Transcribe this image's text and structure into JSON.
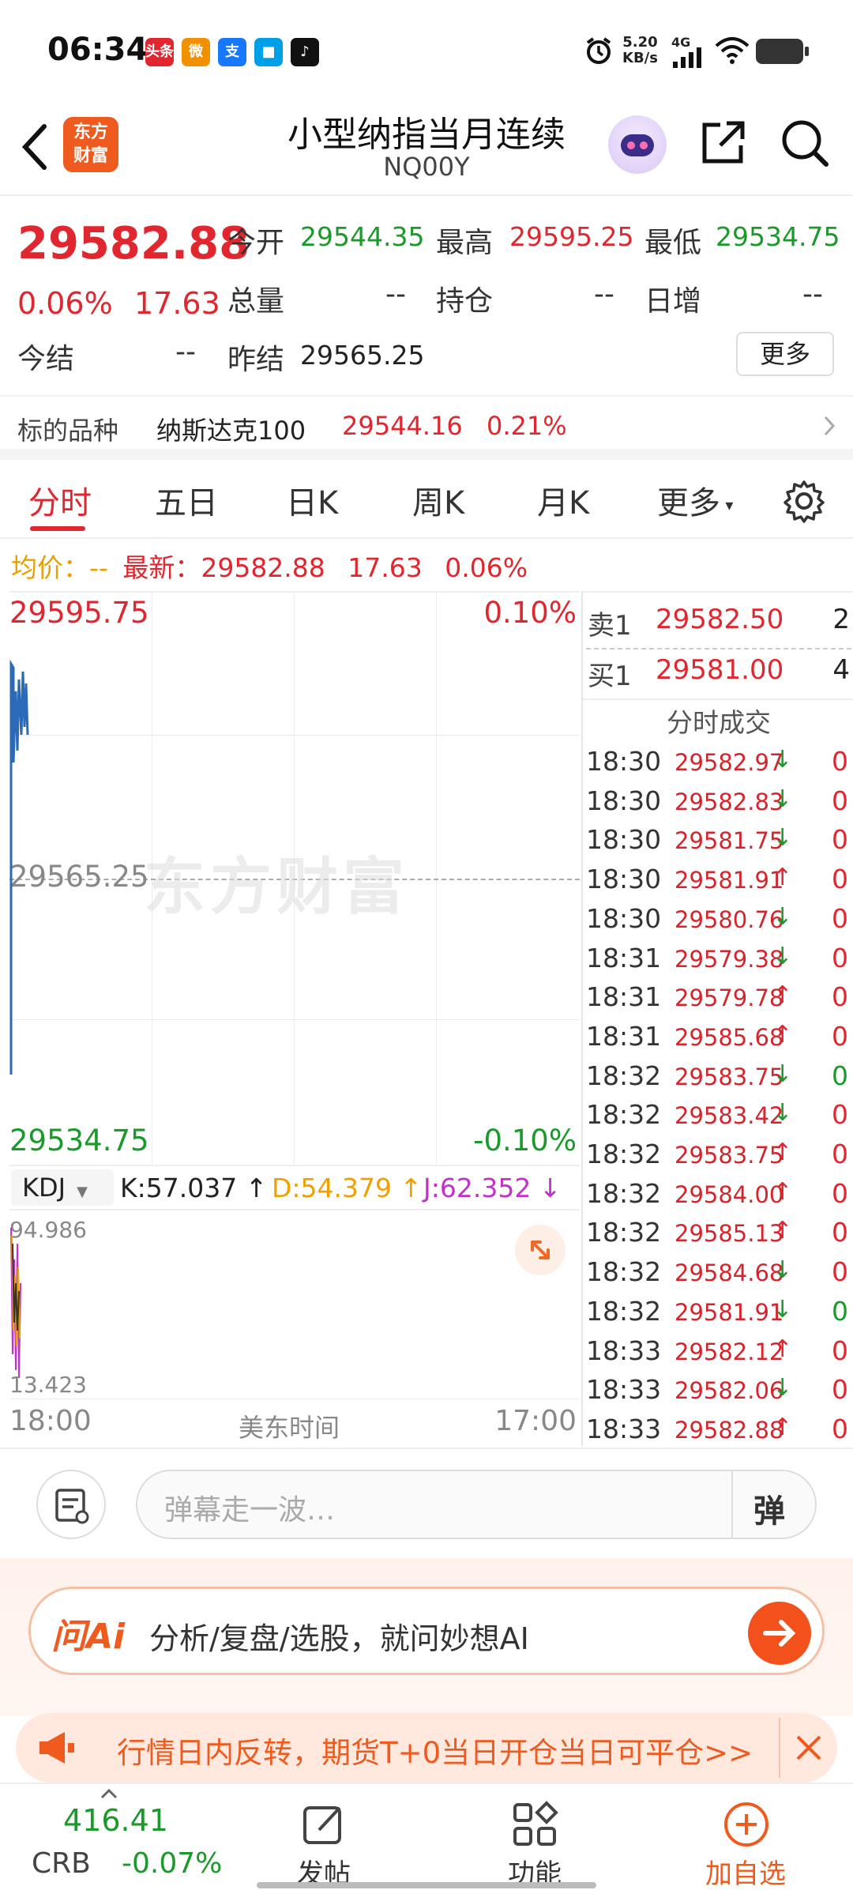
{
  "status_bar": {
    "time": "06:34",
    "app_icons": [
      {
        "name": "toutiao-icon",
        "label": "头条",
        "color": "#e0262e"
      },
      {
        "name": "weibo-icon",
        "label": "微",
        "color": "#f29100"
      },
      {
        "name": "alipay-icon",
        "label": "支",
        "color": "#1677ff"
      },
      {
        "name": "app-icon",
        "label": "■",
        "color": "#00a0e9"
      },
      {
        "name": "tiktok-icon",
        "label": "♪",
        "color": "#111111"
      }
    ],
    "net_speed": "5.20",
    "net_unit": "KB/s",
    "network": "4G"
  },
  "header": {
    "logo_text": "东方财富",
    "title": "小型纳指当月连续",
    "code": "NQ00Y"
  },
  "quote": {
    "price": "29582.88",
    "change_pct": "0.06%",
    "change": "17.63",
    "open_label": "今开",
    "open": "29544.35",
    "high_label": "最高",
    "high": "29595.25",
    "low_label": "最低",
    "low": "29534.75",
    "volume_label": "总量",
    "volume": "--",
    "oi_label": "持仓",
    "oi": "--",
    "daily_inc_label": "日增",
    "daily_inc": "--",
    "settle_label": "今结",
    "settle": "--",
    "prev_settle_label": "昨结",
    "prev_settle": "29565.25",
    "more_label": "更多"
  },
  "underlying": {
    "label": "标的品种",
    "name": "纳斯达克100",
    "price": "29544.16",
    "change_pct": "0.21%"
  },
  "tabs": [
    "分时",
    "五日",
    "日K",
    "周K",
    "月K",
    "更多"
  ],
  "active_tab": 0,
  "latest_line": {
    "avg_label": "均价：",
    "avg_value": "--",
    "latest_label": "最新：",
    "latest_value": "29582.88",
    "change": "17.63",
    "change_pct": "0.06%"
  },
  "chart_data": {
    "type": "line",
    "x_start": "18:00",
    "x_end": "17:00",
    "x_label": "美东时间",
    "y_max": "29595.75",
    "y_min": "29534.75",
    "y_mid": "29565.25",
    "pct_max": "0.10%",
    "pct_min": "-0.10%",
    "ylim": [
      29534.75,
      29595.75
    ],
    "watermark": "东方财富",
    "kdj": {
      "selector": "KDJ",
      "k_label": "K:57.037 ↑",
      "d_label": "D:54.379 ↑",
      "j_label": "J:62.352 ↓",
      "axis_max": "94.986",
      "axis_min": "13.423"
    }
  },
  "order_book": {
    "ask_label": "卖1",
    "ask_price": "29582.50",
    "ask_vol": "2",
    "bid_label": "买1",
    "bid_price": "29581.00",
    "bid_vol": "4"
  },
  "trades_title": "分时成交",
  "trades": [
    {
      "time": "18:30",
      "price": "29582.97",
      "dir": "↓",
      "vol": "0",
      "vcolor": "red"
    },
    {
      "time": "18:30",
      "price": "29582.83",
      "dir": "↓",
      "vol": "0",
      "vcolor": "red"
    },
    {
      "time": "18:30",
      "price": "29581.75",
      "dir": "↓",
      "vol": "0",
      "vcolor": "red"
    },
    {
      "time": "18:30",
      "price": "29581.91",
      "dir": "↑",
      "vol": "0",
      "vcolor": "red"
    },
    {
      "time": "18:30",
      "price": "29580.76",
      "dir": "↓",
      "vol": "0",
      "vcolor": "red"
    },
    {
      "time": "18:31",
      "price": "29579.38",
      "dir": "↓",
      "vol": "0",
      "vcolor": "red"
    },
    {
      "time": "18:31",
      "price": "29579.78",
      "dir": "↑",
      "vol": "0",
      "vcolor": "red"
    },
    {
      "time": "18:31",
      "price": "29585.68",
      "dir": "↑",
      "vol": "0",
      "vcolor": "red"
    },
    {
      "time": "18:32",
      "price": "29583.75",
      "dir": "↓",
      "vol": "0",
      "vcolor": "green"
    },
    {
      "time": "18:32",
      "price": "29583.42",
      "dir": "↓",
      "vol": "0",
      "vcolor": "red"
    },
    {
      "time": "18:32",
      "price": "29583.75",
      "dir": "↑",
      "vol": "0",
      "vcolor": "red"
    },
    {
      "time": "18:32",
      "price": "29584.00",
      "dir": "↑",
      "vol": "0",
      "vcolor": "red"
    },
    {
      "time": "18:32",
      "price": "29585.13",
      "dir": "↑",
      "vol": "0",
      "vcolor": "red"
    },
    {
      "time": "18:32",
      "price": "29584.68",
      "dir": "↓",
      "vol": "0",
      "vcolor": "red"
    },
    {
      "time": "18:32",
      "price": "29581.91",
      "dir": "↓",
      "vol": "0",
      "vcolor": "green"
    },
    {
      "time": "18:33",
      "price": "29582.12",
      "dir": "↑",
      "vol": "0",
      "vcolor": "red"
    },
    {
      "time": "18:33",
      "price": "29582.06",
      "dir": "↓",
      "vol": "0",
      "vcolor": "red"
    },
    {
      "time": "18:33",
      "price": "29582.88",
      "dir": "↑",
      "vol": "0",
      "vcolor": "red"
    }
  ],
  "danmu": {
    "placeholder": "弹幕走一波…",
    "danmu_btn": "弹"
  },
  "ai": {
    "brand": "问Ai",
    "prompt": "分析/复盘/选股，就问妙想AI"
  },
  "promo": {
    "text": "行情日内反转，期货T+0当日开仓当日可平仓>>"
  },
  "bottom_nav": {
    "index_value": "416.41",
    "index_name": "CRB",
    "index_change": "-0.07%",
    "post": "发帖",
    "function": "功能",
    "add_watch": "加自选"
  }
}
